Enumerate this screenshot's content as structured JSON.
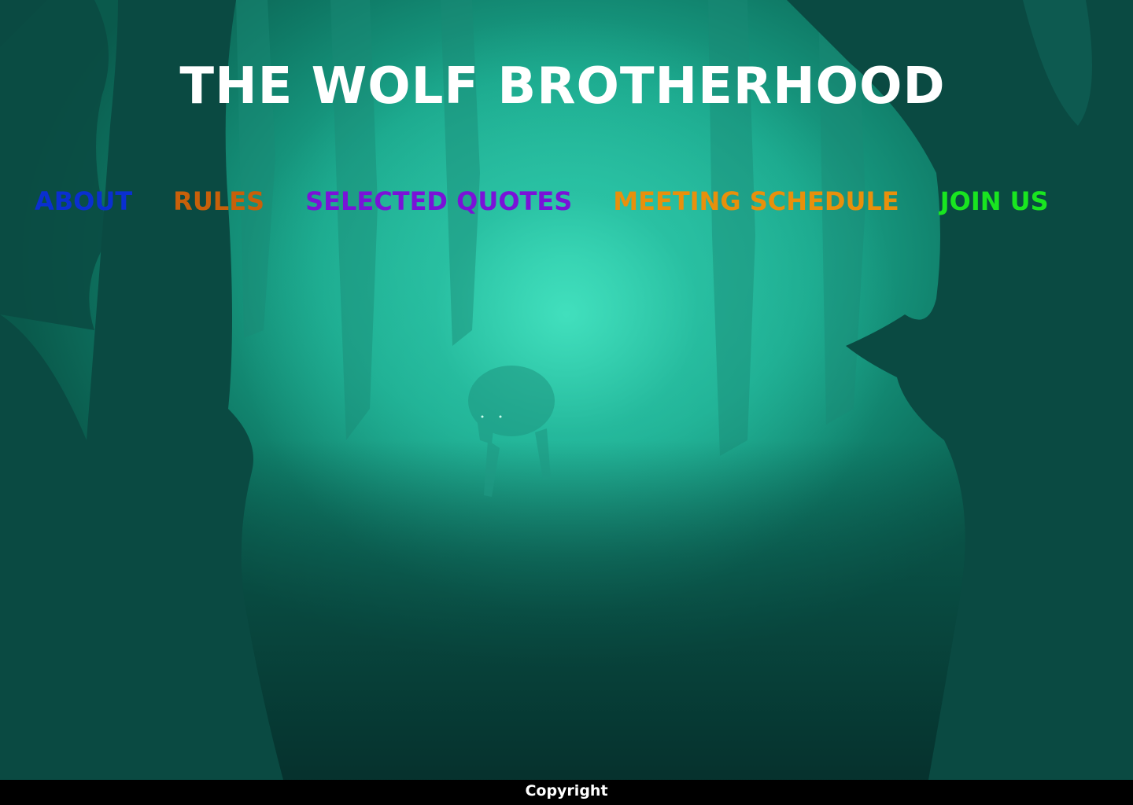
{
  "header": {
    "title": "THE WOLF BROTHERHOOD"
  },
  "nav": {
    "items": [
      {
        "label": "ABOUT",
        "color": "#0a2fd0"
      },
      {
        "label": "RULES",
        "color": "#c8600a"
      },
      {
        "label": "SELECTED QUOTES",
        "color": "#7a12d8"
      },
      {
        "label": "MEETING SCHEDULE",
        "color": "#e8900c"
      },
      {
        "label": "JOIN US",
        "color": "#19e620"
      }
    ]
  },
  "footer": {
    "text": "Copyright"
  },
  "colors": {
    "background_fog": "#2cc4a4",
    "footer_bg": "#000000",
    "title_text": "#ffffff"
  }
}
